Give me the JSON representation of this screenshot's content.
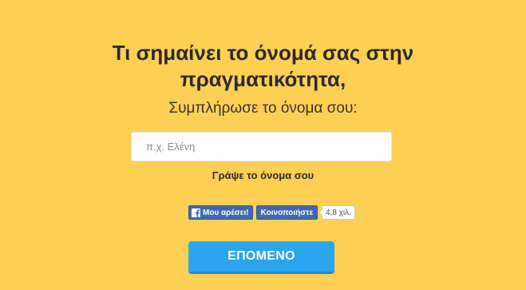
{
  "title": {
    "line1": "Τι σημαίνει το όνομά σας στην",
    "line2": "πραγματικότητα,"
  },
  "subtitle": "Συμπλήρωσε το όνομα σου:",
  "name_input": {
    "value": "",
    "placeholder": "π.χ. Ελένη"
  },
  "hint": "Γράψε το όνομα σου",
  "facebook": {
    "like_label": "Μου αρέσει!",
    "share_label": "Κοινοποιήστε",
    "count": "4,8 χιλ.",
    "icon": "facebook-icon",
    "color": "#4267b2"
  },
  "next_button": {
    "label": "ΕΠΟΜΕΝΟ",
    "color": "#2aa5ee"
  },
  "colors": {
    "background": "#fdd054",
    "text": "#2a2a2a"
  }
}
